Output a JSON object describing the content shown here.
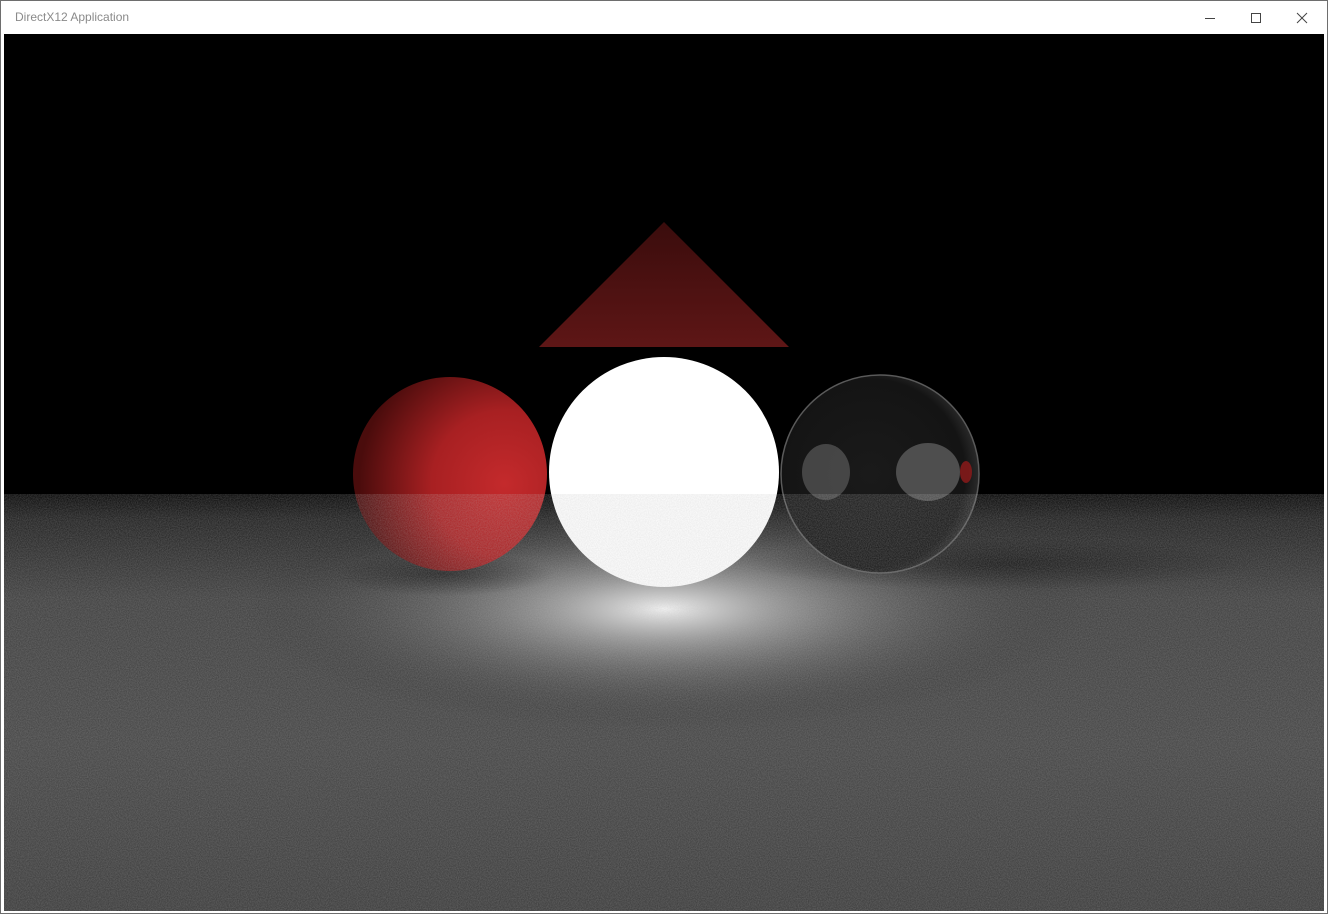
{
  "window": {
    "title": "DirectX12 Application"
  },
  "controls": {
    "minimize_icon": "minimize-icon",
    "maximize_icon": "maximize-icon",
    "close_icon": "close-icon"
  },
  "scene": {
    "background_color": "#000000",
    "floor_color": "#4a4a4a",
    "red_sphere_color": "#c0282a",
    "light_sphere_color": "#ffffff",
    "glass_sphere_color": "#3c3c3c",
    "triangle_color": "#5a1414"
  }
}
